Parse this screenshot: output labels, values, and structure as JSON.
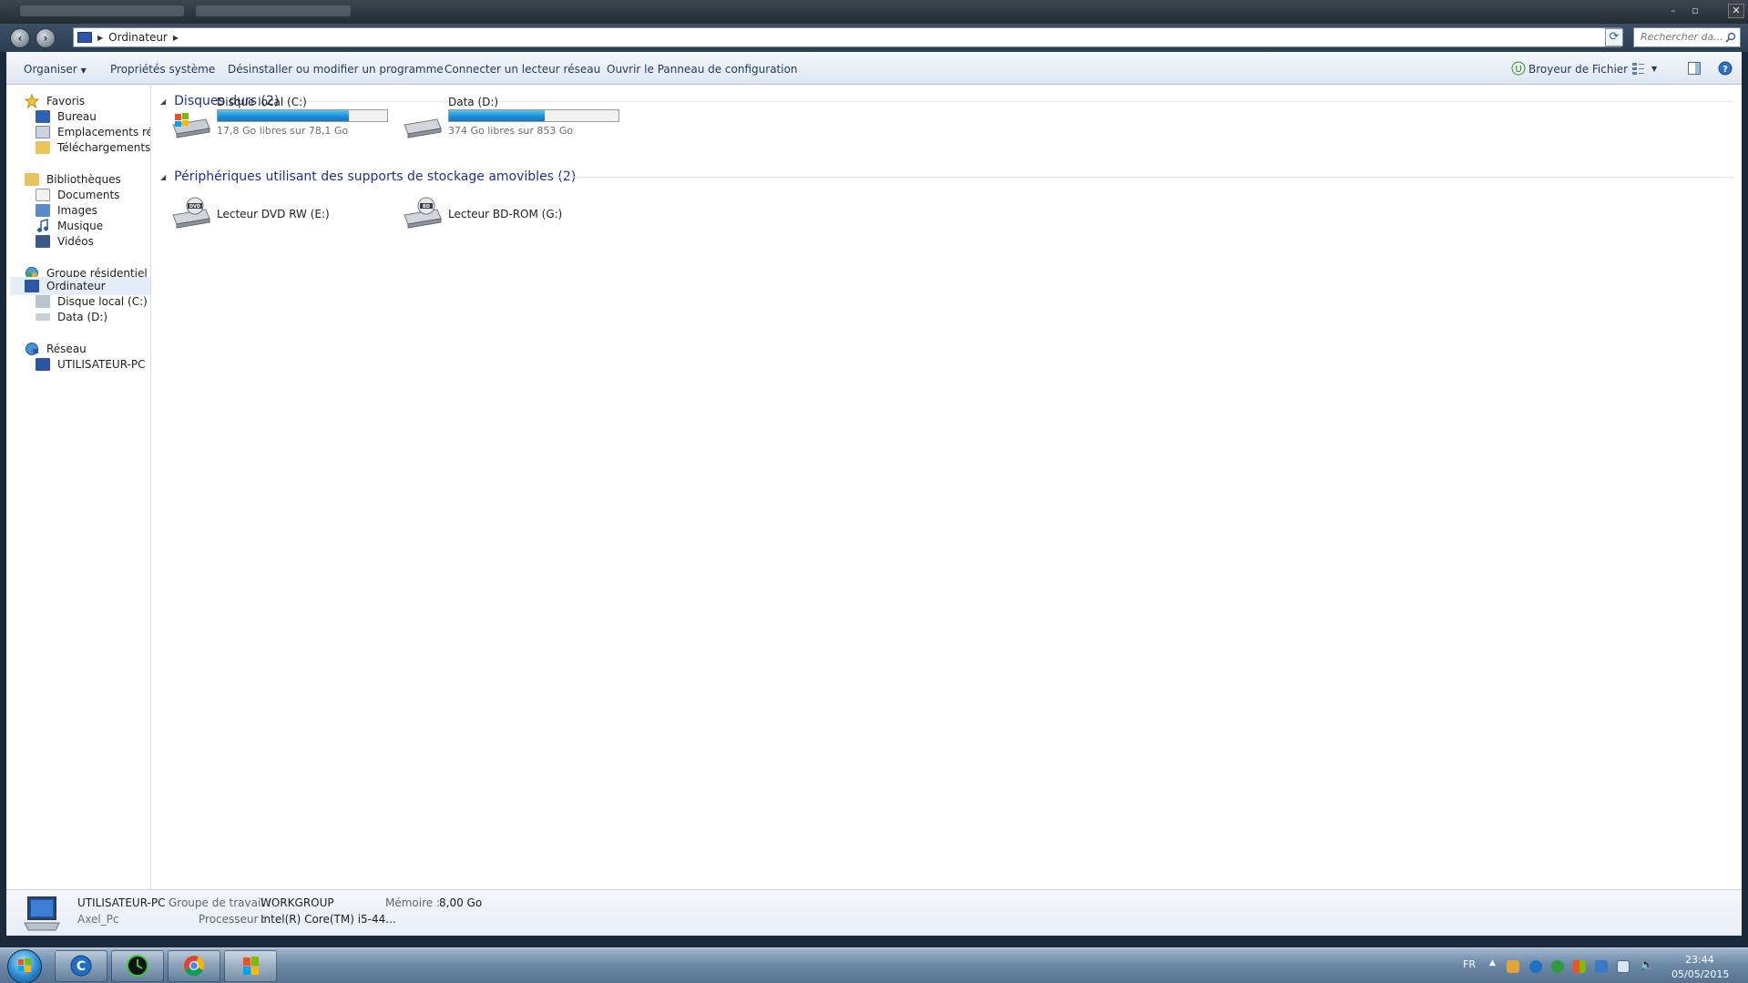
{
  "nav": {
    "crumb": "Ordinateur",
    "search_placeholder": "Rechercher da..."
  },
  "commands": {
    "organize": "Organiser",
    "system_properties": "Propriétés système",
    "uninstall": "Désinstaller ou modifier un programme",
    "map_drive": "Connecter un lecteur réseau",
    "control_panel": "Ouvrir le Panneau de configuration",
    "shredder": "Broyeur de Fichier"
  },
  "sidebar": {
    "favorites": "Favoris",
    "favorites_items": [
      "Bureau",
      "Emplacements récents",
      "Téléchargements"
    ],
    "libraries": "Bibliothèques",
    "libraries_items": [
      "Documents",
      "Images",
      "Musique",
      "Vidéos"
    ],
    "homegroup": "Groupe résidentiel",
    "computer": "Ordinateur",
    "computer_items": [
      "Disque local (C:)",
      "Data (D:)"
    ],
    "network": "Réseau",
    "network_items": [
      "UTILISATEUR-PC"
    ]
  },
  "hard_drives": {
    "header": "Disques durs (2)",
    "drives": [
      {
        "name": "Disque local (C:)",
        "space": "17,8 Go libres sur 78,1 Go",
        "used_fraction": 0.772
      },
      {
        "name": "Data (D:)",
        "space": "374 Go libres sur 853 Go",
        "used_fraction": 0.562
      }
    ]
  },
  "removable": {
    "header": "Périphériques utilisant des supports de stockage amovibles (2)",
    "devices": [
      {
        "name": "Lecteur DVD RW (E:)",
        "badge": "DVD"
      },
      {
        "name": "Lecteur BD-ROM (G:)",
        "badge": "BD"
      }
    ]
  },
  "details": {
    "computer_name": "UTILISATEUR-PC",
    "user": "Axel_Pc",
    "workgroup_label": "Groupe de travail :",
    "workgroup_value": "WORKGROUP",
    "memory_label": "Mémoire :",
    "memory_value": "8,00 Go",
    "processor_label": "Processeur :",
    "processor_value": "Intel(R) Core(TM) i5-44..."
  },
  "taskbar": {
    "language": "FR",
    "time": "23:44",
    "date": "05/05/2015"
  },
  "colors": {
    "accent_bar": "#1d8ed7",
    "group_header": "#1e3287",
    "command_text": "#1e395b"
  }
}
